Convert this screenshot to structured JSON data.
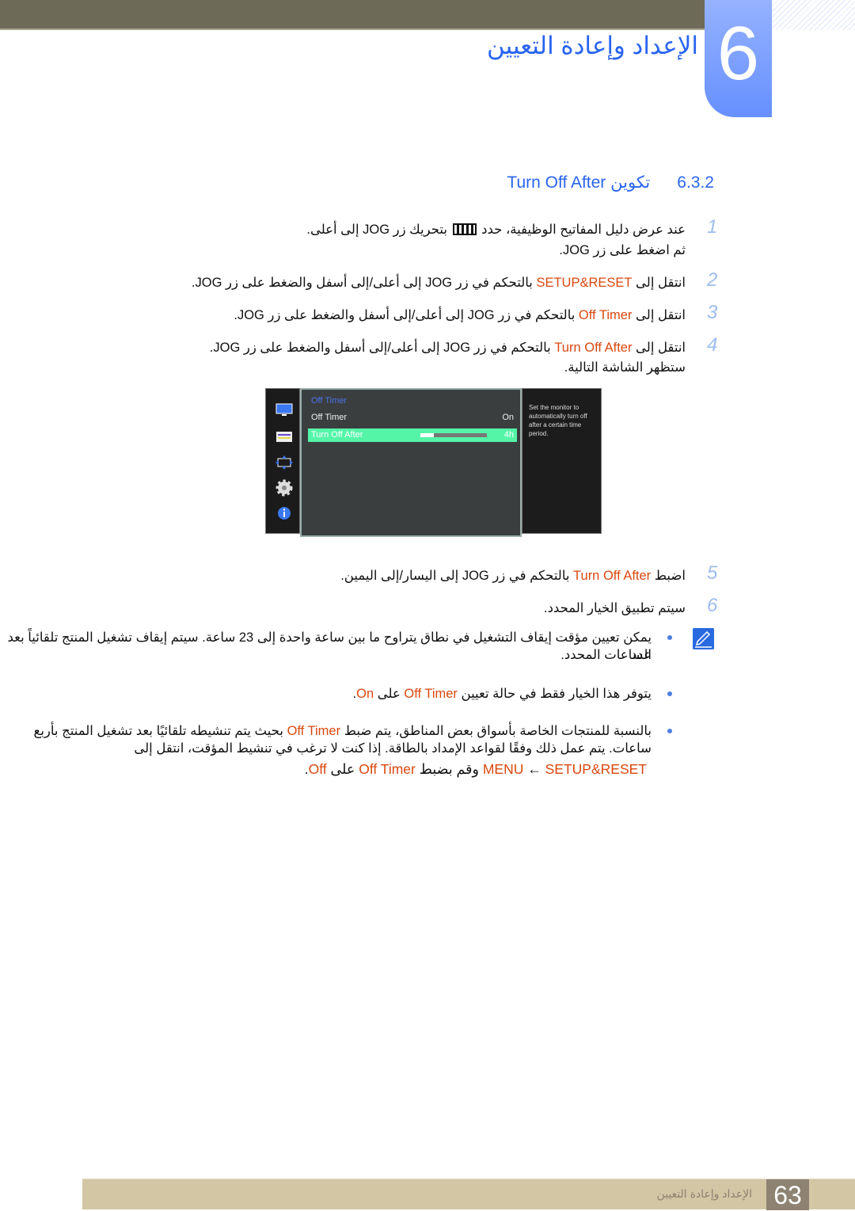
{
  "header": {
    "chapter_number": "6",
    "chapter_title": "الإعداد وإعادة التعيين",
    "section_number": "6.3.2",
    "section_title": "تكوين Turn Off After"
  },
  "colors": {
    "accent": "#2a64ef",
    "highlight": "#d9480f",
    "osd_selected": "#55f5a8"
  },
  "steps": [
    {
      "num": "1",
      "lines": [
        [
          {
            "t": "عند عرض دليل المفاتيح الوظيفية، حدد "
          },
          {
            "icon": "jog-menu-icon"
          },
          {
            "t": " بتحريك زر JOG إلى أعلى."
          }
        ],
        [
          {
            "t": "ثم اضغط على زر JOG."
          }
        ]
      ]
    },
    {
      "num": "2",
      "lines": [
        [
          {
            "t": "انتقل إلى "
          },
          {
            "t": "SETUP&RESET",
            "hl": true
          },
          {
            "t": " بالتحكم في زر JOG إلى أعلى/إلى أسفل والضغط على زر JOG."
          }
        ]
      ]
    },
    {
      "num": "3",
      "lines": [
        [
          {
            "t": "انتقل إلى "
          },
          {
            "t": "Off Timer",
            "hl": true
          },
          {
            "t": " بالتحكم في زر JOG إلى أعلى/إلى أسفل والضغط على زر JOG."
          }
        ]
      ]
    },
    {
      "num": "4",
      "lines": [
        [
          {
            "t": "انتقل إلى "
          },
          {
            "t": "Turn Off After",
            "hl": true
          },
          {
            "t": " بالتحكم في زر JOG إلى أعلى/إلى أسفل والضغط على زر JOG."
          }
        ],
        [
          {
            "t": "ستظهر الشاشة التالية."
          }
        ]
      ]
    },
    {
      "num": "5",
      "lines": [
        [
          {
            "t": "اضبط "
          },
          {
            "t": "Turn Off After",
            "hl": true
          },
          {
            "t": " بالتحكم في زر JOG إلى اليسار/إلى اليمين."
          }
        ]
      ]
    },
    {
      "num": "6",
      "lines": [
        [
          {
            "t": "سيتم تطبيق الخيار المحدد."
          }
        ]
      ]
    }
  ],
  "osd": {
    "menu_title": "Off Timer",
    "rows": [
      {
        "label": "Off Timer",
        "value": "On"
      },
      {
        "label": "Turn Off After",
        "value": "4h",
        "slider_fraction": 0.2,
        "selected": true
      }
    ],
    "help": "Set the monitor to automatically turn off after a certain time period.",
    "side_icons": [
      "picture-icon",
      "onscreen-display-icon",
      "position-icon",
      "gear-icon",
      "info-icon"
    ]
  },
  "notes": [
    {
      "lines": [
        [
          {
            "t": "يمكن تعيين مؤقت إيقاف التشغيل في نطاق يتراوح ما بين ساعة واحدة إلى 23 ساعة. سيتم إيقاف تشغيل المنتج تلقائياً بعد عدد"
          }
        ],
        [
          {
            "t": "الساعات المحدد."
          }
        ]
      ]
    },
    {
      "lines": [
        [
          {
            "t": "يتوفر هذا الخيار فقط في حالة تعيين "
          },
          {
            "t": "Off Timer",
            "hl": true
          },
          {
            "t": " على "
          },
          {
            "t": "On",
            "hl": true
          },
          {
            "t": "."
          }
        ]
      ]
    },
    {
      "lines": [
        [
          {
            "t": "بالنسبة للمنتجات الخاصة بأسواق بعض المناطق، يتم ضبط "
          },
          {
            "t": "Off Timer",
            "hl": true
          },
          {
            "t": " بحيث يتم تنشيطه تلقائيًا بعد تشغيل المنتج بأربع"
          }
        ],
        [
          {
            "t": "ساعات. يتم عمل ذلك وفقًا لقواعد الإمداد بالطاقة. إذا كنت لا ترغب في تنشيط المؤقت، انتقل إلى"
          }
        ],
        [
          {
            "t": "SETUP&RESET",
            "hl": true
          },
          {
            "t": " ← "
          },
          {
            "t": "MENU",
            "hl": true
          },
          {
            "t": " وقم بضبط "
          },
          {
            "t": "Off Timer",
            "hl": true
          },
          {
            "t": " على "
          },
          {
            "t": "Off",
            "hl": true
          },
          {
            "t": "."
          }
        ]
      ]
    }
  ],
  "footer": {
    "title": "الإعداد وإعادة التعيين",
    "page": "63"
  }
}
